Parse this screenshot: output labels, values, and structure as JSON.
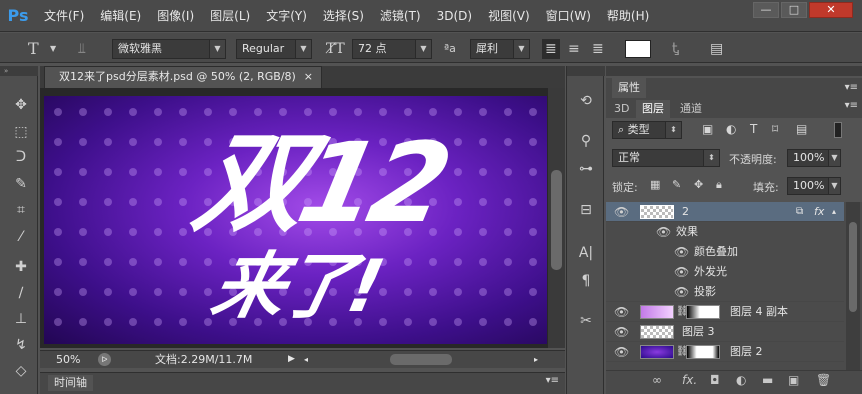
{
  "app": {
    "logo": "Ps"
  },
  "menu": [
    "文件(F)",
    "编辑(E)",
    "图像(I)",
    "图层(L)",
    "文字(Y)",
    "选择(S)",
    "滤镜(T)",
    "3D(D)",
    "视图(V)",
    "窗口(W)",
    "帮助(H)"
  ],
  "window_controls": {
    "minimize": "—",
    "maximize": "□",
    "close": "✕"
  },
  "options": {
    "tool_glyph": "T",
    "font_family": "微软雅黑",
    "font_style": "Regular",
    "font_size": "72 点",
    "aa_label": "ªa",
    "antialias": "犀利",
    "color_swatch": "#ffffff"
  },
  "document": {
    "tab_title": "双12来了psd分层素材.psd @ 50% (2, RGB/8)",
    "close": "×",
    "art_line1": "双12",
    "art_line2": "来了!",
    "zoom": "50%",
    "doc_info": "文档:2.29M/11.7M",
    "timeline_label": "时间轴"
  },
  "panel": {
    "header": "属性",
    "tabs": [
      "3D",
      "图层",
      "通道"
    ],
    "active_tab": "图层",
    "filter": "类型",
    "blend_mode": "正常",
    "opacity_label": "不透明度:",
    "opacity": "100%",
    "lock_label": "锁定:",
    "fill_label": "填充:",
    "fill": "100%",
    "layers": [
      {
        "name": "2",
        "selected": true,
        "fx": "fx"
      },
      {
        "name": "效果",
        "sub": true,
        "level": 1
      },
      {
        "name": "颜色叠加",
        "sub": true,
        "level": 2
      },
      {
        "name": "外发光",
        "sub": true,
        "level": 2
      },
      {
        "name": "投影",
        "sub": true,
        "level": 2
      },
      {
        "name": "图层 4 副本"
      },
      {
        "name": "图层 3"
      },
      {
        "name": "图层 2"
      }
    ],
    "bottom_buttons": [
      "∞",
      "fx.",
      "◘",
      "◐",
      "▬",
      "▣",
      "🗑"
    ]
  },
  "colors": {
    "accent": "#3c9bea",
    "selected_row": "#5a6c80",
    "canvas_purple": "#6b22c2"
  }
}
